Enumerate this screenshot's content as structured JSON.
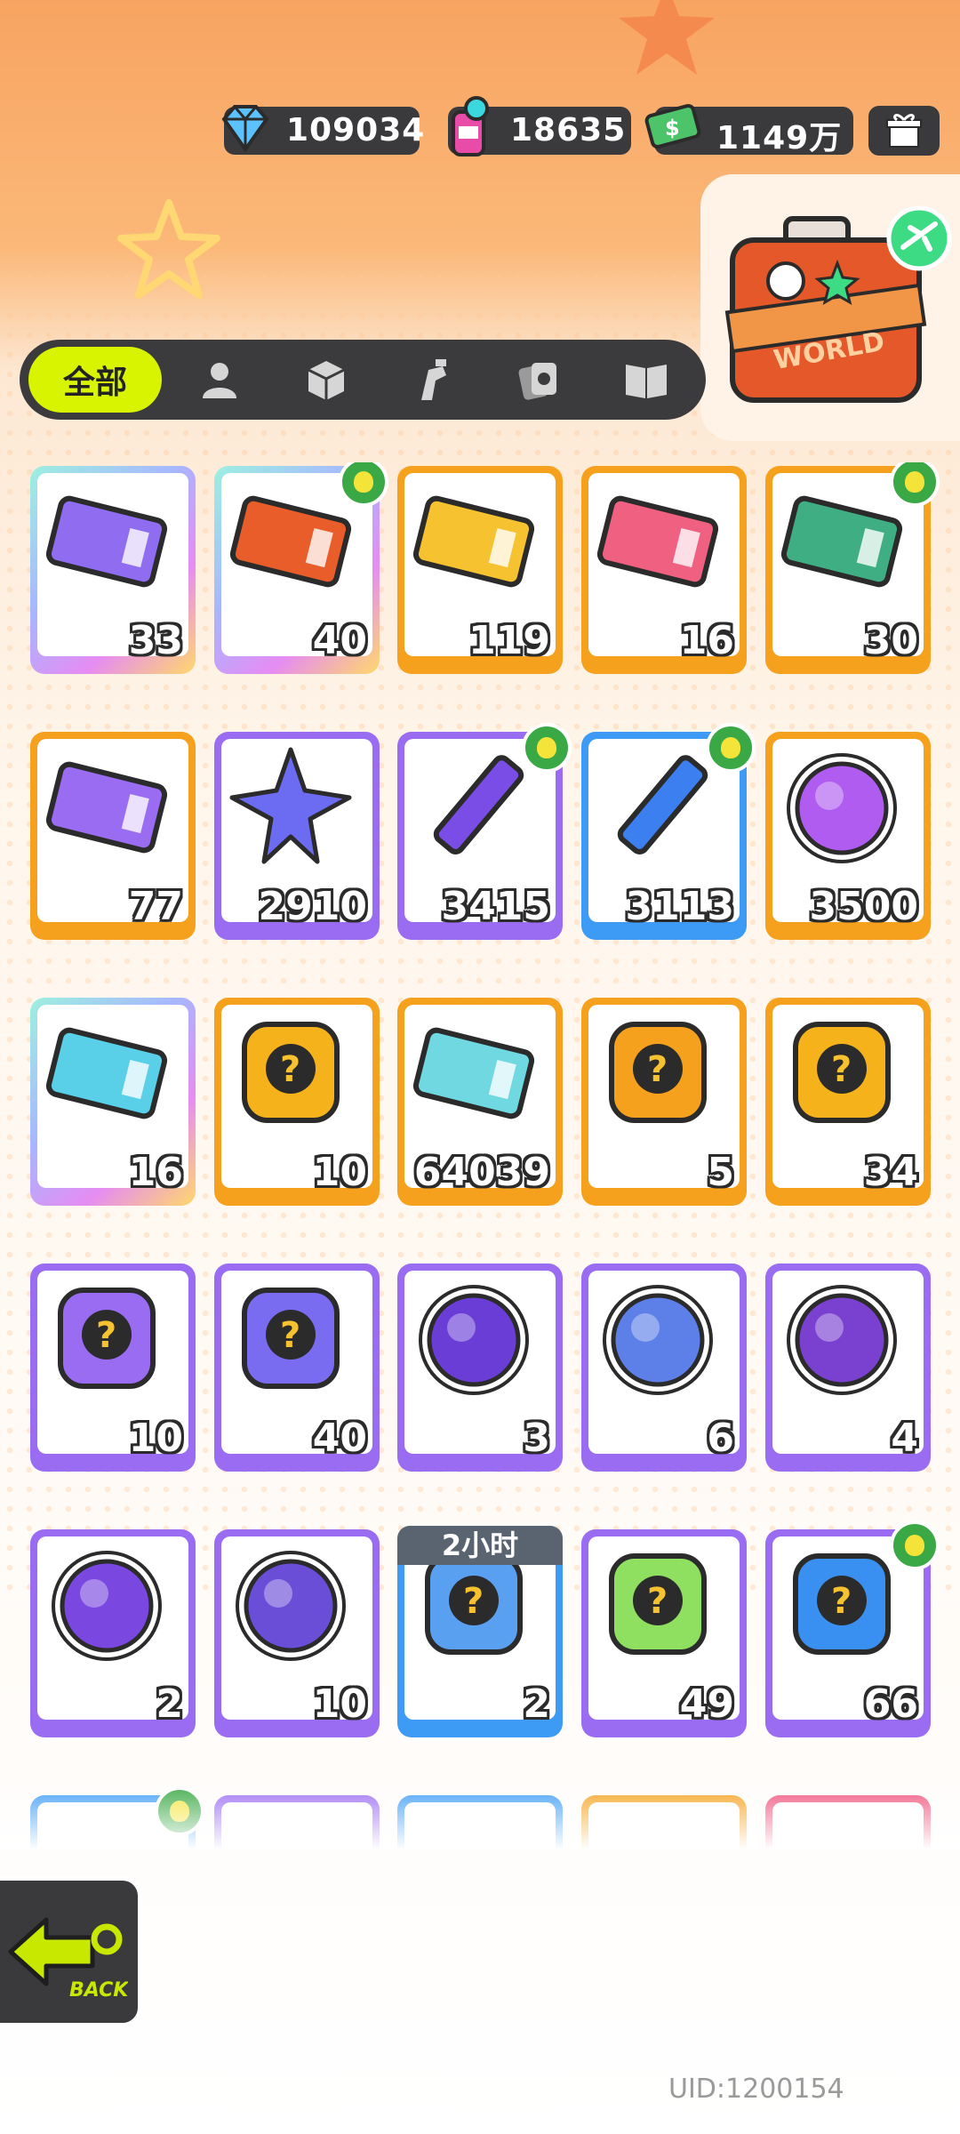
{
  "currencies": [
    {
      "name": "diamond",
      "icon": "diamond-icon",
      "value": "109034"
    },
    {
      "name": "paint",
      "icon": "paint-can-icon",
      "value": "18635"
    },
    {
      "name": "cash",
      "icon": "cash-icon",
      "value": "1149万"
    }
  ],
  "world_card": {
    "label": "WORLD"
  },
  "tabs": [
    {
      "id": "all",
      "label": "全部",
      "active": true
    },
    {
      "id": "character",
      "icon": "person-icon"
    },
    {
      "id": "box",
      "icon": "box-icon"
    },
    {
      "id": "spray",
      "icon": "spray-icon"
    },
    {
      "id": "cards",
      "icon": "cards-icon"
    },
    {
      "id": "book",
      "icon": "book-icon"
    }
  ],
  "items": [
    {
      "count": "33",
      "border": "rainbow",
      "art": "purple-crown-ticket",
      "badge": false
    },
    {
      "count": "40",
      "border": "rainbow",
      "art": "lion-dance-ticket",
      "badge": true
    },
    {
      "count": "119",
      "border": "#f5a11d",
      "art": "gold-star-ticket",
      "badge": false
    },
    {
      "count": "16",
      "border": "#f5a11d",
      "art": "character-ticket",
      "badge": false
    },
    {
      "count": "30",
      "border": "#f5a11d",
      "art": "peach-ticket",
      "badge": true
    },
    {
      "count": "77",
      "border": "#f5a11d",
      "art": "purple-star-ticket",
      "badge": false
    },
    {
      "count": "2910",
      "border": "#9a6cf2",
      "art": "purple-star",
      "badge": false
    },
    {
      "count": "3415",
      "border": "#9a6cf2",
      "art": "purple-crayon",
      "badge": true
    },
    {
      "count": "3113",
      "border": "#3d9bf5",
      "art": "blue-crayon",
      "badge": true
    },
    {
      "count": "3500",
      "border": "#f5a11d",
      "art": "cool-sticker",
      "badge": false
    },
    {
      "count": "16",
      "border": "rainbow",
      "art": "lottery-ticket",
      "badge": false
    },
    {
      "count": "10",
      "border": "#f5a11d",
      "art": "burst-badge",
      "badge": false
    },
    {
      "count": "64039",
      "border": "#f5a11d",
      "art": "season-ticket",
      "badge": false
    },
    {
      "count": "5",
      "border": "#f5a11d",
      "art": "mystery-egg",
      "badge": false
    },
    {
      "count": "34",
      "border": "#f5a11d",
      "art": "deity-mystery",
      "badge": false
    },
    {
      "count": "10",
      "border": "#9a6cf2",
      "art": "deity-mystery-purple",
      "badge": false
    },
    {
      "count": "40",
      "border": "#9a6cf2",
      "art": "travel-card",
      "badge": false
    },
    {
      "count": "3",
      "border": "#9a6cf2",
      "art": "mpets-bat",
      "badge": false
    },
    {
      "count": "6",
      "border": "#9a6cf2",
      "art": "mpets-bird",
      "badge": false
    },
    {
      "count": "4",
      "border": "#9a6cf2",
      "art": "mpets-fish",
      "badge": false
    },
    {
      "count": "2",
      "border": "#9a6cf2",
      "art": "mpets-yellow",
      "badge": false
    },
    {
      "count": "10",
      "border": "#9a6cf2",
      "art": "mpets-sprout",
      "badge": false
    },
    {
      "count": "2",
      "border": "#3d9bf5",
      "art": "alarm-clock",
      "badge": false,
      "timer": "2小时"
    },
    {
      "count": "49",
      "border": "#9a6cf2",
      "art": "green-jelly",
      "badge": false
    },
    {
      "count": "66",
      "border": "#9a6cf2",
      "art": "spray-can",
      "badge": true
    },
    {
      "count": "",
      "border": "#3d9bf5",
      "art": "partial",
      "badge": true
    },
    {
      "count": "",
      "border": "#9a6cf2",
      "art": "partial",
      "badge": false
    },
    {
      "count": "",
      "border": "#3d9bf5",
      "art": "partial",
      "badge": false
    },
    {
      "count": "",
      "border": "#f5a11d",
      "art": "partial",
      "badge": false
    },
    {
      "count": "",
      "border": "#f0507a",
      "art": "partial",
      "badge": false
    }
  ],
  "back_button": {
    "label": "BACK"
  },
  "uid": "UID:1200154"
}
